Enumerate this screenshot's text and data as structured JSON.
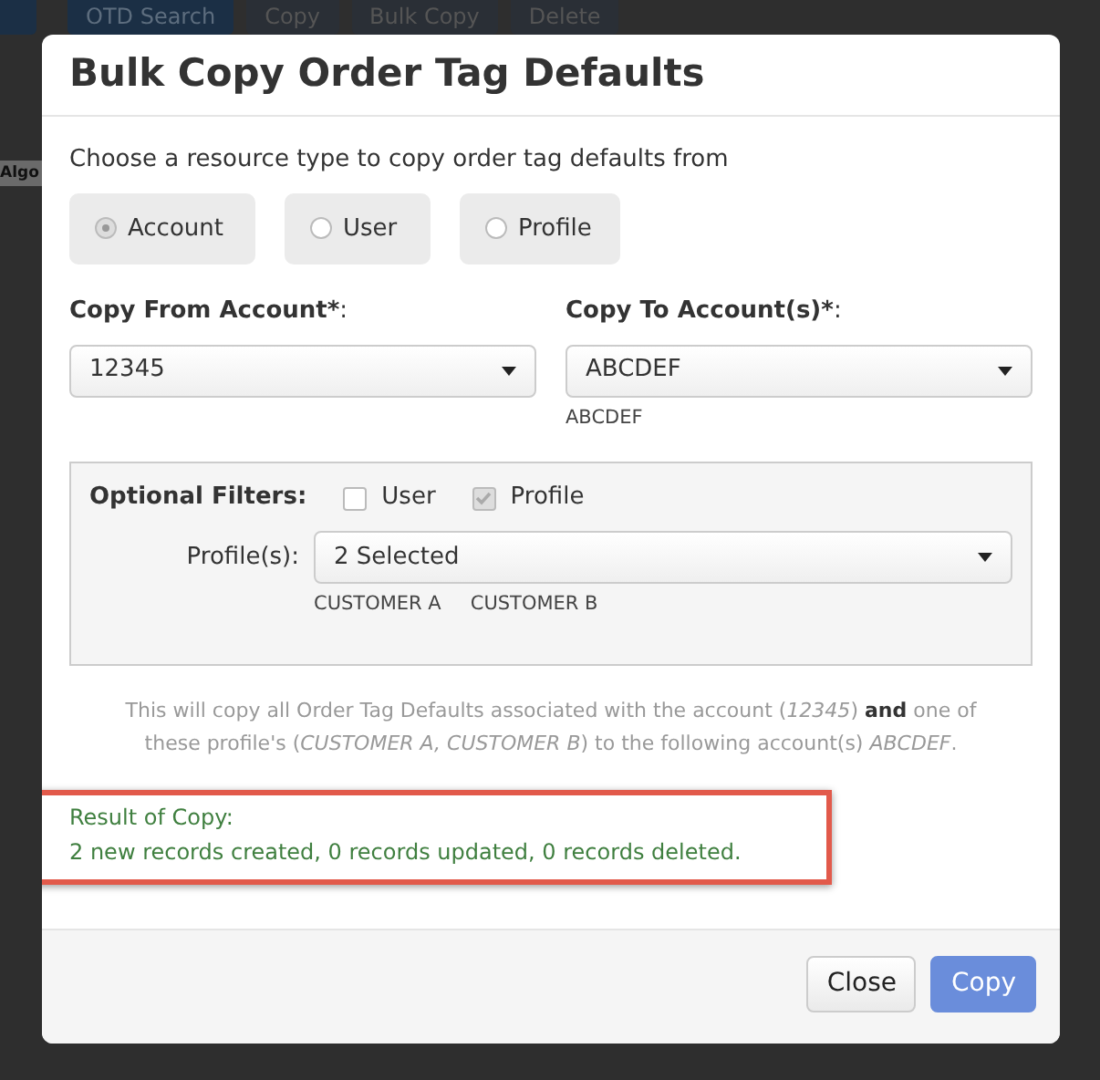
{
  "background": {
    "toolbar": [
      {
        "label": "OTD Search",
        "kind": "search"
      },
      {
        "label": "Copy",
        "kind": "plain"
      },
      {
        "label": "Bulk Copy",
        "kind": "bulk"
      },
      {
        "label": "Delete",
        "kind": "delete"
      }
    ],
    "side_text": "Algo"
  },
  "modal": {
    "title": "Bulk Copy Order Tag Defaults",
    "prompt": "Choose a resource type to copy order tag defaults from",
    "resource_types": [
      {
        "label": "Account",
        "selected": true
      },
      {
        "label": "User",
        "selected": false
      },
      {
        "label": "Profile",
        "selected": false
      }
    ],
    "copy_from": {
      "label": "Copy From Account*",
      "suffix": ":",
      "value": "12345"
    },
    "copy_to": {
      "label": "Copy To Account(s)*",
      "suffix": ":",
      "value": "ABCDEF",
      "chosen": [
        "ABCDEF"
      ]
    },
    "filters": {
      "label": "Optional Filters",
      "suffix": ":",
      "options": [
        {
          "label": "User",
          "checked": false
        },
        {
          "label": "Profile",
          "checked": true
        }
      ],
      "profiles_label": "Profile(s):",
      "profiles_value": "2 Selected",
      "profiles_chosen": [
        "CUSTOMER A",
        "CUSTOMER B"
      ]
    },
    "summary": "This will copy all Order Tag Defaults associated with the account (*12345*) **and** one of these profile's (*CUSTOMER A, CUSTOMER B*) to the following account(s) *ABCDEF*.",
    "result": {
      "highlighted": true,
      "title": "Result of Copy:",
      "message": "2 new records created, 0 records updated, 0 records deleted."
    },
    "buttons": [
      {
        "label": "Close",
        "kind": "secondary"
      },
      {
        "label": "Copy",
        "kind": "primary"
      }
    ]
  }
}
